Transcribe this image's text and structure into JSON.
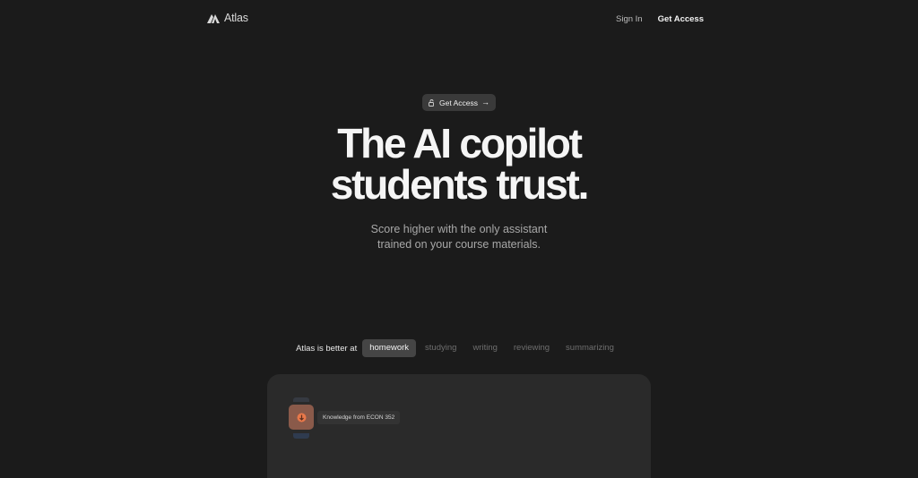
{
  "nav": {
    "brand": "Atlas",
    "sign_in": "Sign In",
    "get_access": "Get Access"
  },
  "hero": {
    "pill_label": "Get Access",
    "pill_arrow": "→",
    "headline_line1": "The AI copilot",
    "headline_line2": "students trust.",
    "sub_line1": "Score higher with the only assistant",
    "sub_line2": "trained on your course materials."
  },
  "features": {
    "lead": "Atlas is better at",
    "tabs": [
      {
        "label": "homework",
        "active": true
      },
      {
        "label": "studying",
        "active": false
      },
      {
        "label": "writing",
        "active": false
      },
      {
        "label": "reviewing",
        "active": false
      },
      {
        "label": "summarizing",
        "active": false
      }
    ]
  },
  "card": {
    "knowledge_label": "Knowledge from ECON 352"
  },
  "colors": {
    "background": "#1b1b1b",
    "card": "#2a2a2a",
    "active_tab": "#454545",
    "accent_tile": "#8a5a4a",
    "accent_glyph": "#e8784a"
  }
}
